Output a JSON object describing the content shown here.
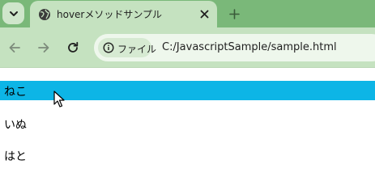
{
  "tab": {
    "title": "hoverメソッドサンプル",
    "favicon_icon": "globe-icon",
    "close_icon": "close-icon"
  },
  "tabstrip": {
    "tab_list_icon": "chevron-down-icon",
    "new_tab_icon": "plus-icon"
  },
  "toolbar": {
    "back_icon": "arrow-left-icon",
    "forward_icon": "arrow-right-icon",
    "reload_icon": "reload-icon"
  },
  "omnibox": {
    "chip_icon": "info-icon",
    "chip_label": "ファイル",
    "url": "C:/JavascriptSample/sample.html"
  },
  "page": {
    "items": [
      {
        "label": "ねこ",
        "hovered": true
      },
      {
        "label": "いぬ",
        "hovered": false
      },
      {
        "label": "はと",
        "hovered": false
      }
    ]
  },
  "colors": {
    "tabstrip": "#7ab879",
    "toolbar": "#c5e2c0",
    "hover_highlight": "#0db5e6"
  }
}
